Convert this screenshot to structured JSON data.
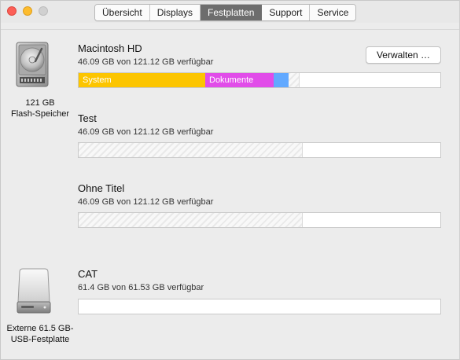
{
  "window": {
    "tabs": [
      "Übersicht",
      "Displays",
      "Festplatten",
      "Support",
      "Service"
    ],
    "active_tab": "Festplatten"
  },
  "disks": [
    {
      "icon": "internal-drive-icon",
      "capacity": "121 GB",
      "type": "Flash-Speicher",
      "volumes": [
        {
          "name": "Macintosh HD",
          "availability": "46.09 GB von 121.12 GB verfügbar",
          "manage_label": "Verwalten …",
          "usage": {
            "segments": [
              {
                "label": "System",
                "fraction": 0.35,
                "color": "#fcc500"
              },
              {
                "label": "Dokumente",
                "fraction": 0.19,
                "color": "#e14ce9"
              },
              {
                "label": "",
                "fraction": 0.04,
                "color": "#62a9ff"
              }
            ],
            "other_fraction": 0.03,
            "free_fraction": 0.39
          }
        },
        {
          "name": "Test",
          "availability": "46.09 GB von 121.12 GB verfügbar",
          "usage": {
            "other_fraction": 0.62,
            "free_fraction": 0.38
          }
        },
        {
          "name": "Ohne Titel",
          "availability": "46.09 GB von 121.12 GB verfügbar",
          "usage": {
            "other_fraction": 0.62,
            "free_fraction": 0.38
          }
        }
      ]
    },
    {
      "icon": "external-drive-icon",
      "capacity": "Externe 61.5 GB-",
      "type": "USB-Festplatte",
      "volumes": [
        {
          "name": "CAT",
          "availability": "61.4 GB von 61.53 GB verfügbar",
          "usage": {
            "other_fraction": 0.0,
            "free_fraction": 1.0
          }
        }
      ]
    }
  ]
}
